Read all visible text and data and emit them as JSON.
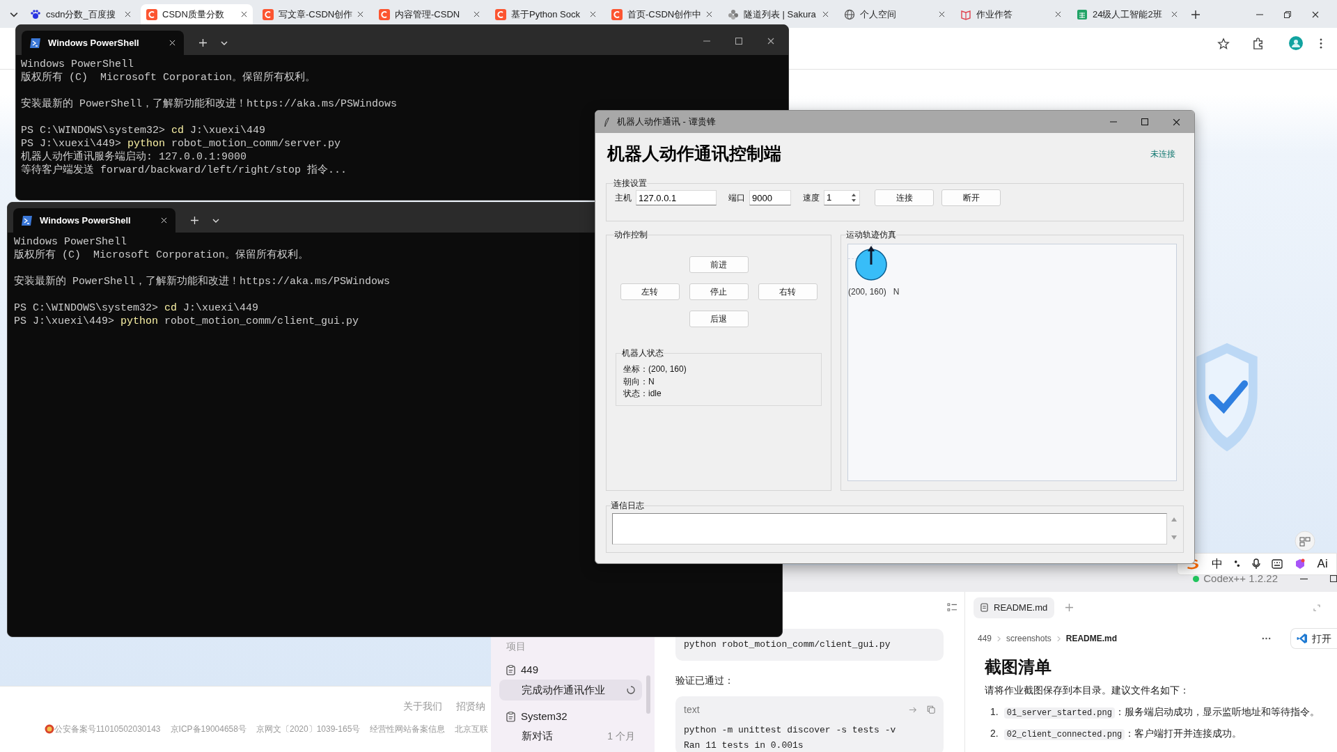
{
  "browser": {
    "tabs": [
      {
        "label": "csdn分数_百度搜",
        "kind": "paw",
        "selected": false
      },
      {
        "label": "CSDN质量分数",
        "kind": "c",
        "selected": true
      },
      {
        "label": "写文章-CSDN创作",
        "kind": "c",
        "selected": false
      },
      {
        "label": "内容管理-CSDN",
        "kind": "c",
        "selected": false
      },
      {
        "label": "基于Python Sock",
        "kind": "c",
        "selected": false
      },
      {
        "label": "首页-CSDN创作中",
        "kind": "c",
        "selected": false
      },
      {
        "label": "隧道列表 | Sakura",
        "kind": "sakura",
        "selected": false
      },
      {
        "label": "个人空间",
        "kind": "globe",
        "selected": false
      },
      {
        "label": "作业作答",
        "kind": "book",
        "selected": false
      },
      {
        "label": "24级人工智能2班",
        "kind": "sheet",
        "selected": false
      }
    ],
    "footer": {
      "links": [
        "关于我们",
        "招贤纳"
      ],
      "records": [
        "公安备案号11010502030143",
        "京ICP备19004658号",
        "京网文〔2020〕1039-165号",
        "经营性网站备案信息",
        "北京互联"
      ]
    }
  },
  "terminals": [
    {
      "tab_title": "Windows PowerShell",
      "paragraphs": [
        [
          [
            {
              "text": "Windows PowerShell",
              "highlight": false
            }
          ],
          [
            {
              "text": "版权所有 (C)  Microsoft Corporation。保留所有权利。",
              "highlight": false
            }
          ]
        ],
        [
          [
            {
              "text": "安装最新的 PowerShell，了解新功能和改进！https://aka.ms/PSWindows",
              "highlight": false
            }
          ]
        ],
        [
          [
            {
              "text": "PS C:\\WINDOWS\\system32> ",
              "highlight": false
            },
            {
              "text": "cd",
              "highlight": true
            },
            {
              "text": " J:\\xuexi\\449",
              "highlight": false
            }
          ],
          [
            {
              "text": "PS J:\\xuexi\\449> ",
              "highlight": false
            },
            {
              "text": "python",
              "highlight": true
            },
            {
              "text": " robot_motion_comm/server.py",
              "highlight": false
            }
          ],
          [
            {
              "text": "机器人动作通讯服务端启动: 127.0.0.1:9000",
              "highlight": false
            }
          ],
          [
            {
              "text": "等待客户端发送 forward/backward/left/right/stop 指令...",
              "highlight": false
            }
          ]
        ]
      ]
    },
    {
      "tab_title": "Windows PowerShell",
      "paragraphs": [
        [
          [
            {
              "text": "Windows PowerShell",
              "highlight": false
            }
          ],
          [
            {
              "text": "版权所有 (C)  Microsoft Corporation。保留所有权利。",
              "highlight": false
            }
          ]
        ],
        [
          [
            {
              "text": "安装最新的 PowerShell，了解新功能和改进！https://aka.ms/PSWindows",
              "highlight": false
            }
          ]
        ],
        [
          [
            {
              "text": "PS C:\\WINDOWS\\system32> ",
              "highlight": false
            },
            {
              "text": "cd",
              "highlight": true
            },
            {
              "text": " J:\\xuexi\\449",
              "highlight": false
            }
          ],
          [
            {
              "text": "PS J:\\xuexi\\449> ",
              "highlight": false
            },
            {
              "text": "python",
              "highlight": true
            },
            {
              "text": " robot_motion_comm/client_gui.py",
              "highlight": false
            }
          ]
        ]
      ]
    }
  ],
  "robot_app": {
    "window_title": "机器人动作通讯 - 谭贵锋",
    "heading": "机器人动作通讯控制端",
    "connection_status": "未连接",
    "connection": {
      "title": "连接设置",
      "host_label": "主机",
      "host": "127.0.0.1",
      "port_label": "端口",
      "port": "9000",
      "speed_label": "速度",
      "speed": "1",
      "buttons": [
        "连接",
        "断开"
      ]
    },
    "motion": {
      "title": "动作控制",
      "button_rows": [
        [
          "前进"
        ],
        [
          "左转",
          "停止",
          "右转"
        ],
        [
          "后退"
        ]
      ],
      "status": {
        "title": "机器人状态",
        "lines": [
          "坐标：(200, 160)",
          "朝向：N",
          "状态：idle"
        ]
      }
    },
    "trajectory": {
      "title": "运动轨迹仿真",
      "position_label": "(200, 160)",
      "heading_label": "N"
    },
    "log": {
      "title": "通信日志"
    }
  },
  "codex": {
    "version": "Codex++ 1.2.22",
    "sidebar": {
      "section_title": "项目",
      "projects": [
        {
          "name": "449",
          "chats": [
            {
              "title": "完成动作通讯作业",
              "selected": true,
              "busy": true
            }
          ]
        },
        {
          "name": "System32",
          "chats": [
            {
              "title": "新对话",
              "selected": false,
              "busy": false,
              "time": "1 个月"
            }
          ]
        }
      ]
    },
    "conversation": [
      {
        "kind": "code",
        "lines": [
          "python robot_motion_comm/client_gui.py"
        ]
      },
      {
        "kind": "text",
        "text": "验证已通过："
      },
      {
        "kind": "code",
        "language": "text",
        "lines": [
          "python -m unittest discover -s tests -v",
          "Ran 11 tests in 0.001s"
        ]
      }
    ],
    "document": {
      "tab": "README.md",
      "breadcrumb": [
        "449",
        "screenshots",
        "README.md"
      ],
      "open_button": "打开",
      "heading": "截图清单",
      "intro": "请将作业截图保存到本目录。建议文件名如下：",
      "items": [
        {
          "number": "1.",
          "file": "01_server_started.png",
          "text": "：服务端启动成功，显示监听地址和等待指令。"
        },
        {
          "number": "2.",
          "file": "02_client_connected.png",
          "text": "：客户端打开并连接成功。"
        }
      ]
    }
  },
  "ime_bar": {
    "language": "中",
    "ai_label": "Ai"
  }
}
